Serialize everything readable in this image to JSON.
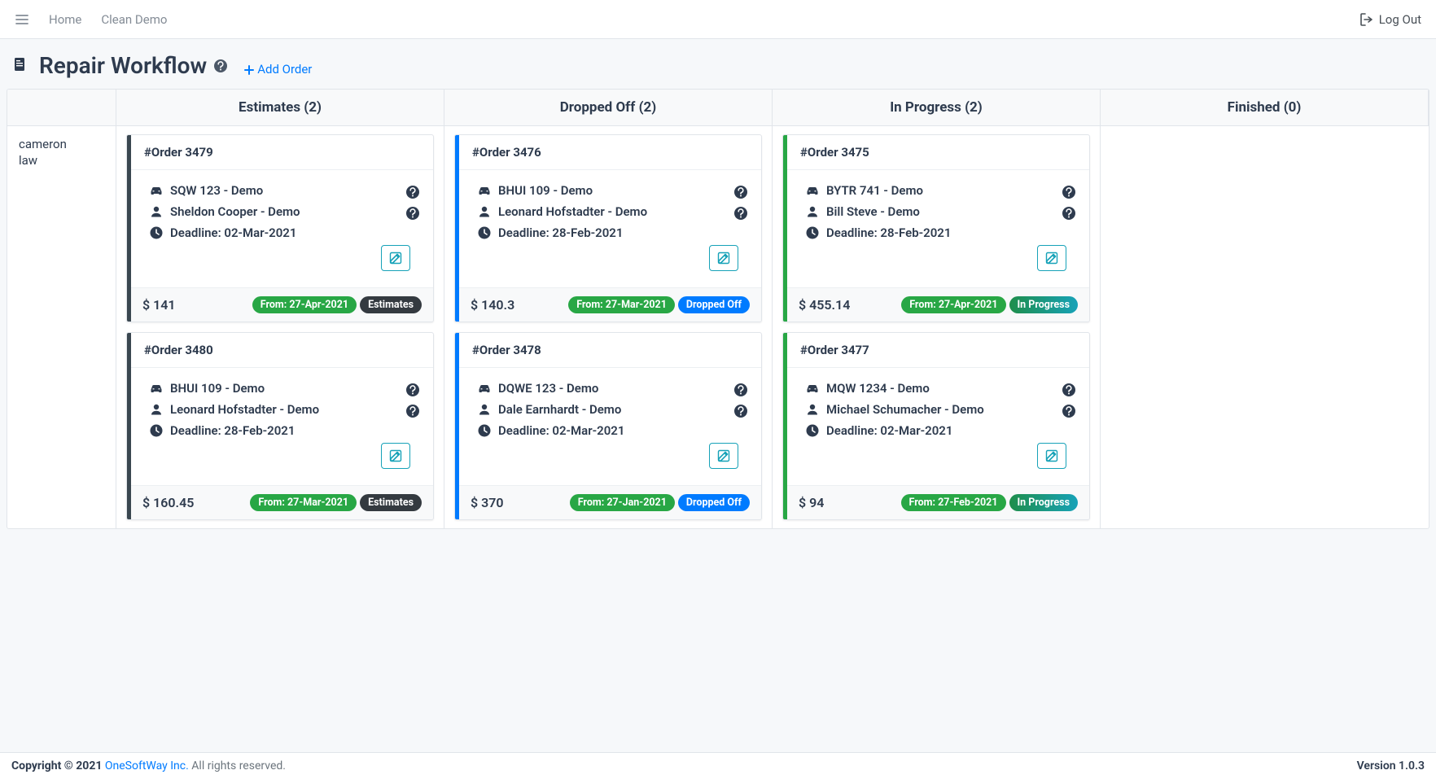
{
  "nav": {
    "home": "Home",
    "clean_demo": "Clean Demo",
    "logout": "Log Out"
  },
  "header": {
    "title": "Repair Workflow",
    "add_order": "Add Order"
  },
  "columns": {
    "estimates": {
      "label": "Estimates (2)"
    },
    "dropped_off": {
      "label": "Dropped Off (2)"
    },
    "in_progress": {
      "label": "In Progress (2)"
    },
    "finished": {
      "label": "Finished (0)"
    }
  },
  "row_label_line1": "cameron",
  "row_label_line2": "law",
  "cards": {
    "est": [
      {
        "order": "#Order 3479",
        "vehicle": "SQW 123 - Demo",
        "customer": "Sheldon Cooper - Demo",
        "deadline": "Deadline: 02-Mar-2021",
        "price": "$ 141",
        "from": "From: 27-Apr-2021",
        "status": "Estimates",
        "stripe": "stripe-dark",
        "status_badge": "badge-dark"
      },
      {
        "order": "#Order 3480",
        "vehicle": "BHUI 109 - Demo",
        "customer": "Leonard Hofstadter - Demo",
        "deadline": "Deadline: 28-Feb-2021",
        "price": "$ 160.45",
        "from": "From: 27-Mar-2021",
        "status": "Estimates",
        "stripe": "stripe-dark",
        "status_badge": "badge-dark"
      }
    ],
    "drop": [
      {
        "order": "#Order 3476",
        "vehicle": "BHUI 109 - Demo",
        "customer": "Leonard Hofstadter - Demo",
        "deadline": "Deadline: 28-Feb-2021",
        "price": "$ 140.3",
        "from": "From: 27-Mar-2021",
        "status": "Dropped Off",
        "stripe": "stripe-blue",
        "status_badge": "badge-blue"
      },
      {
        "order": "#Order 3478",
        "vehicle": "DQWE 123 - Demo",
        "customer": "Dale Earnhardt - Demo",
        "deadline": "Deadline: 02-Mar-2021",
        "price": "$ 370",
        "from": "From: 27-Jan-2021",
        "status": "Dropped Off",
        "stripe": "stripe-blue",
        "status_badge": "badge-blue"
      }
    ],
    "prog": [
      {
        "order": "#Order 3475",
        "vehicle": "BYTR 741 - Demo",
        "customer": "Bill Steve - Demo",
        "deadline": "Deadline: 28-Feb-2021",
        "price": "$ 455.14",
        "from": "From: 27-Apr-2021",
        "status": "In Progress",
        "stripe": "stripe-green",
        "status_badge": "badge-teal"
      },
      {
        "order": "#Order 3477",
        "vehicle": "MQW 1234 - Demo",
        "customer": "Michael Schumacher - Demo",
        "deadline": "Deadline: 02-Mar-2021",
        "price": "$ 94",
        "from": "From: 27-Feb-2021",
        "status": "In Progress",
        "stripe": "stripe-green",
        "status_badge": "badge-teal"
      }
    ],
    "fin": []
  },
  "footer": {
    "copyright_bold": "Copyright © 2021 ",
    "company": "OneSoftWay Inc.",
    "rights": " All rights reserved.",
    "version": "Version 1.0.3"
  }
}
